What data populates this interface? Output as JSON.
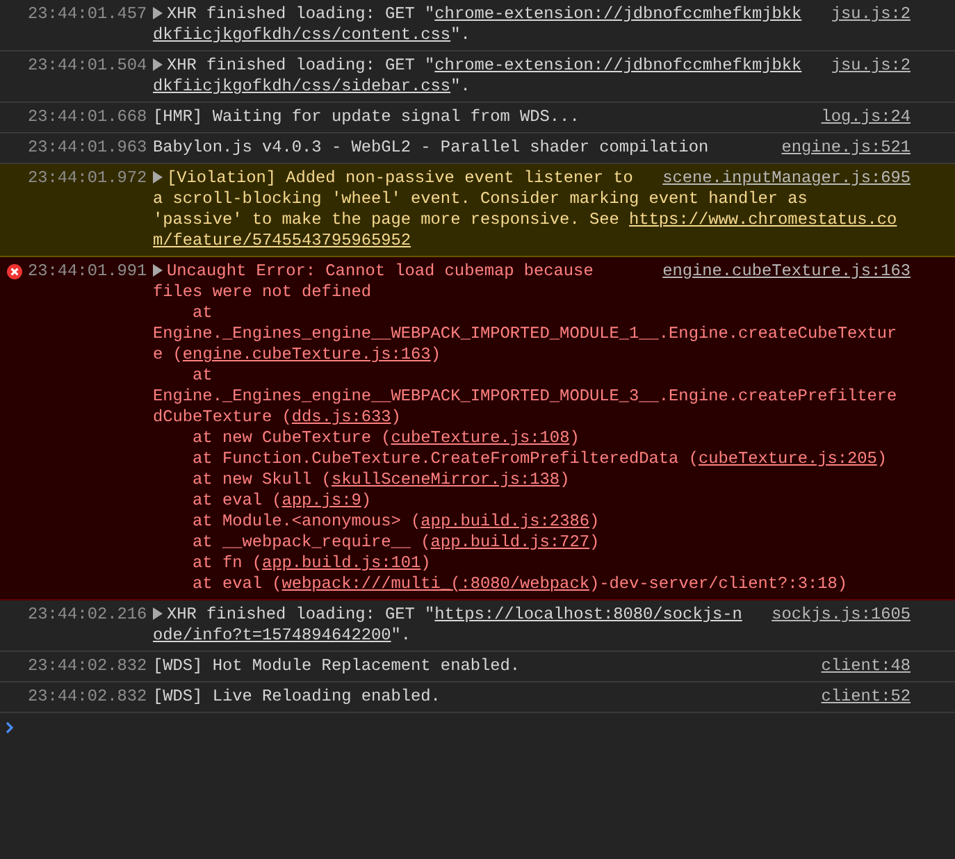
{
  "messages": [
    {
      "kind": "info",
      "timestamp": "23:44:01.457",
      "expandable": true,
      "source": "jsu.js:2",
      "lines": [
        [
          {
            "kind": "text",
            "text": "XHR finished loading: GET \""
          },
          {
            "kind": "link",
            "text": "chrome-extension://jdbnofccmhefkmjbkk"
          }
        ],
        [
          {
            "kind": "link",
            "text": "dkfiicjkgofkdh/css/content.css"
          },
          {
            "kind": "text",
            "text": "\"."
          }
        ]
      ]
    },
    {
      "kind": "info",
      "timestamp": "23:44:01.504",
      "expandable": true,
      "source": "jsu.js:2",
      "lines": [
        [
          {
            "kind": "text",
            "text": "XHR finished loading: GET \""
          },
          {
            "kind": "link",
            "text": "chrome-extension://jdbnofccmhefkmjbkk"
          }
        ],
        [
          {
            "kind": "link",
            "text": "dkfiicjkgofkdh/css/sidebar.css"
          },
          {
            "kind": "text",
            "text": "\"."
          }
        ]
      ]
    },
    {
      "kind": "info",
      "timestamp": "23:44:01.668",
      "expandable": false,
      "source": "log.js:24",
      "lines": [
        [
          {
            "kind": "text",
            "text": "[HMR] Waiting for update signal from WDS..."
          }
        ]
      ]
    },
    {
      "kind": "info",
      "timestamp": "23:44:01.963",
      "expandable": false,
      "source": "engine.js:521",
      "lines": [
        [
          {
            "kind": "text",
            "text": "Babylon.js v4.0.3 - WebGL2 - Parallel shader compilation"
          }
        ]
      ]
    },
    {
      "kind": "warning",
      "timestamp": "23:44:01.972",
      "expandable": true,
      "source": "scene.inputManager.js:695",
      "lines": [
        [
          {
            "kind": "text",
            "text": "[Violation] Added non-passive event listener to"
          }
        ],
        [
          {
            "kind": "text",
            "text": "a scroll-blocking 'wheel' event. Consider marking event handler as"
          }
        ],
        [
          {
            "kind": "text",
            "text": "'passive' to make the page more responsive. See "
          },
          {
            "kind": "link",
            "text": "https://www.chromestatus.co"
          }
        ],
        [
          {
            "kind": "link",
            "text": "m/feature/5745543795965952"
          }
        ]
      ]
    },
    {
      "kind": "error",
      "timestamp": "23:44:01.991",
      "expandable": true,
      "source": "engine.cubeTexture.js:163",
      "lines": [
        [
          {
            "kind": "text",
            "text": "Uncaught Error: Cannot load cubemap because"
          }
        ],
        [
          {
            "kind": "text",
            "text": "files were not defined"
          }
        ],
        [
          {
            "kind": "text",
            "text": "    at"
          }
        ],
        [
          {
            "kind": "text",
            "text": "Engine._Engines_engine__WEBPACK_IMPORTED_MODULE_1__.Engine.createCubeTextur"
          }
        ],
        [
          {
            "kind": "text",
            "text": "e ("
          },
          {
            "kind": "link",
            "text": "engine.cubeTexture.js:163"
          },
          {
            "kind": "text",
            "text": ")"
          }
        ],
        [
          {
            "kind": "text",
            "text": "    at"
          }
        ],
        [
          {
            "kind": "text",
            "text": "Engine._Engines_engine__WEBPACK_IMPORTED_MODULE_3__.Engine.createPrefiltere"
          }
        ],
        [
          {
            "kind": "text",
            "text": "dCubeTexture ("
          },
          {
            "kind": "link",
            "text": "dds.js:633"
          },
          {
            "kind": "text",
            "text": ")"
          }
        ],
        [
          {
            "kind": "text",
            "text": "    at new CubeTexture ("
          },
          {
            "kind": "link",
            "text": "cubeTexture.js:108"
          },
          {
            "kind": "text",
            "text": ")"
          }
        ],
        [
          {
            "kind": "text",
            "text": "    at Function.CubeTexture.CreateFromPrefilteredData ("
          },
          {
            "kind": "link",
            "text": "cubeTexture.js:205"
          },
          {
            "kind": "text",
            "text": ")"
          }
        ],
        [
          {
            "kind": "text",
            "text": "    at new Skull ("
          },
          {
            "kind": "link",
            "text": "skullSceneMirror.js:138"
          },
          {
            "kind": "text",
            "text": ")"
          }
        ],
        [
          {
            "kind": "text",
            "text": "    at eval ("
          },
          {
            "kind": "link",
            "text": "app.js:9"
          },
          {
            "kind": "text",
            "text": ")"
          }
        ],
        [
          {
            "kind": "text",
            "text": "    at Module.<anonymous> ("
          },
          {
            "kind": "link",
            "text": "app.build.js:2386"
          },
          {
            "kind": "text",
            "text": ")"
          }
        ],
        [
          {
            "kind": "text",
            "text": "    at __webpack_require__ ("
          },
          {
            "kind": "link",
            "text": "app.build.js:727"
          },
          {
            "kind": "text",
            "text": ")"
          }
        ],
        [
          {
            "kind": "text",
            "text": "    at fn ("
          },
          {
            "kind": "link",
            "text": "app.build.js:101"
          },
          {
            "kind": "text",
            "text": ")"
          }
        ],
        [
          {
            "kind": "text",
            "text": "    at eval ("
          },
          {
            "kind": "link",
            "text": "webpack:///multi_(:8080/webpack"
          },
          {
            "kind": "text",
            "text": ")-dev-server/client?:3:18)"
          }
        ]
      ]
    },
    {
      "kind": "info",
      "timestamp": "23:44:02.216",
      "expandable": true,
      "source": "sockjs.js:1605",
      "lines": [
        [
          {
            "kind": "text",
            "text": "XHR finished loading: GET \""
          },
          {
            "kind": "link",
            "text": "https://localhost:8080/sockjs-n"
          }
        ],
        [
          {
            "kind": "link",
            "text": "ode/info?t=1574894642200"
          },
          {
            "kind": "text",
            "text": "\"."
          }
        ]
      ]
    },
    {
      "kind": "info",
      "timestamp": "23:44:02.832",
      "expandable": false,
      "source": "client:48",
      "lines": [
        [
          {
            "kind": "text",
            "text": "[WDS] Hot Module Replacement enabled."
          }
        ]
      ]
    },
    {
      "kind": "info",
      "timestamp": "23:44:02.832",
      "expandable": false,
      "source": "client:52",
      "lines": [
        [
          {
            "kind": "text",
            "text": "[WDS] Live Reloading enabled."
          }
        ]
      ]
    }
  ]
}
